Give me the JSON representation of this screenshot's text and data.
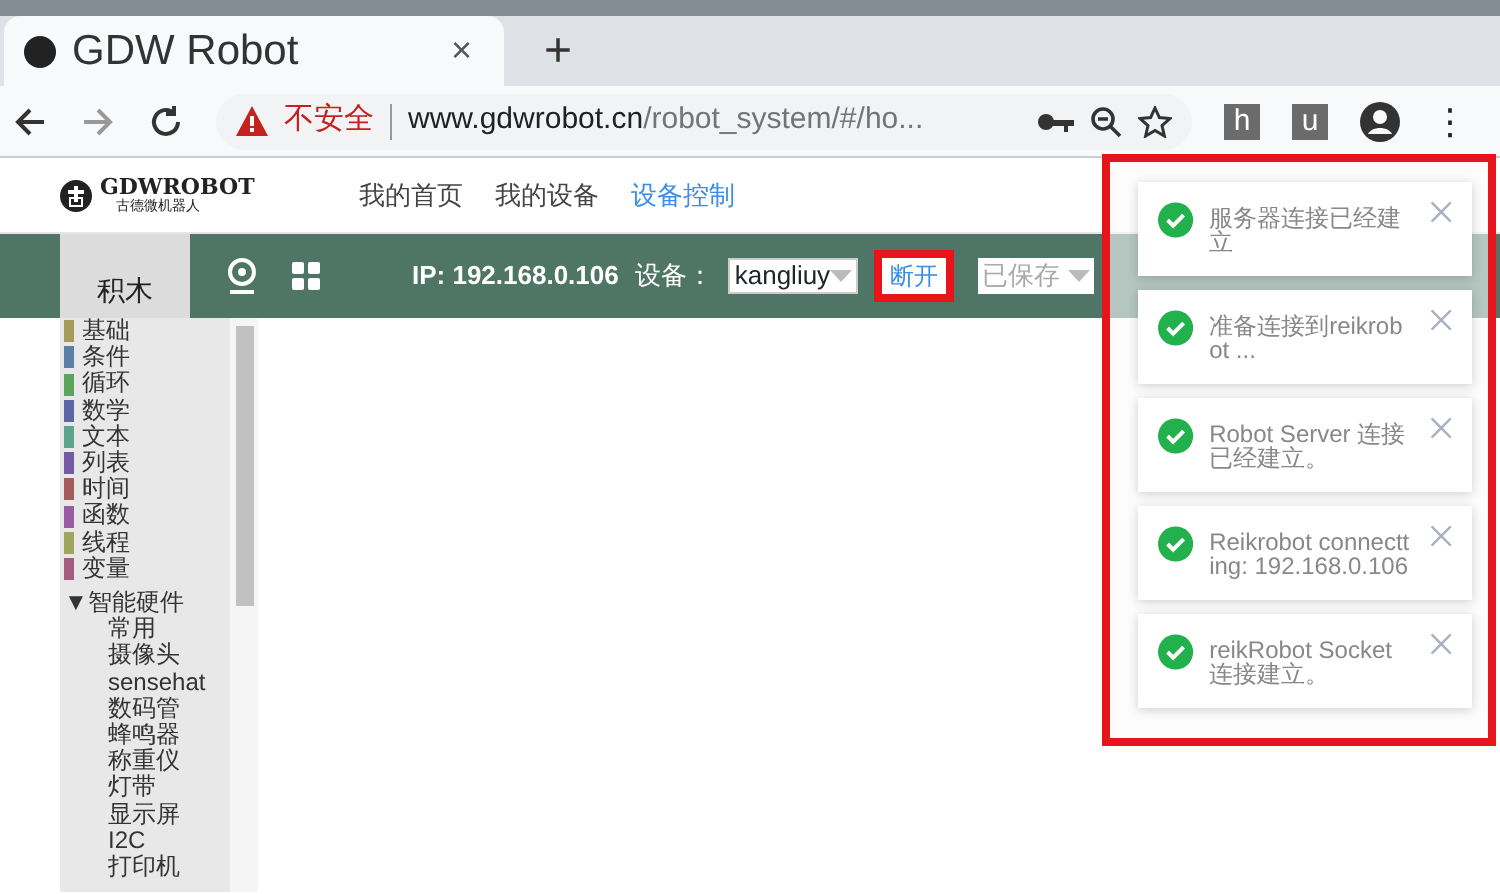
{
  "browser": {
    "tab_title": "GDW Robot",
    "close": "×",
    "new_tab": "+",
    "security": "不安全",
    "url_host": "www.gdwrobot.cn",
    "url_path": "/robot_system/#/ho...",
    "extensions": [
      "h",
      "u"
    ],
    "menu": "⋮"
  },
  "site": {
    "logo_name": "GDWROBOT",
    "logo_sub": "古德微机器人",
    "nav": [
      {
        "label": "我的首页",
        "selected": false
      },
      {
        "label": "我的设备",
        "selected": false
      },
      {
        "label": "设备控制",
        "selected": true
      }
    ]
  },
  "toolbar": {
    "tab": "积木",
    "ip": "IP: 192.168.0.106",
    "device_label": "设备：",
    "device": "kangliuy",
    "disconnect": "断开",
    "disconnect_annotated": true,
    "saved": "已保存"
  },
  "categories": [
    {
      "label": "基础",
      "color": "#a5995b"
    },
    {
      "label": "条件",
      "color": "#5b80a5"
    },
    {
      "label": "循环",
      "color": "#5ba55b"
    },
    {
      "label": "数学",
      "color": "#5b67a5"
    },
    {
      "label": "文本",
      "color": "#5ba58c"
    },
    {
      "label": "列表",
      "color": "#745ba5"
    },
    {
      "label": "时间",
      "color": "#a55b5b"
    },
    {
      "label": "函数",
      "color": "#995ba5"
    },
    {
      "label": "线程",
      "color": "#9fa55b"
    },
    {
      "label": "变量",
      "color": "#a55b80"
    }
  ],
  "hardware": {
    "arrow": "▼",
    "label": "智能硬件",
    "expanded": true,
    "children": [
      "常用",
      "摄像头",
      "sensehat",
      "数码管",
      "蜂鸣器",
      "称重仪",
      "灯带",
      "显示屏",
      "I2C",
      "打印机"
    ]
  },
  "notifications_annotated": true,
  "notifications": [
    {
      "text": "服务器连接已经建立"
    },
    {
      "text": "准备连接到reikrobot ..."
    },
    {
      "text": "Robot Server 连接已经建立。"
    },
    {
      "text": "Reikrobot connectting: 192.168.0.106"
    },
    {
      "text": "reikRobot Socket连接建立。"
    }
  ]
}
